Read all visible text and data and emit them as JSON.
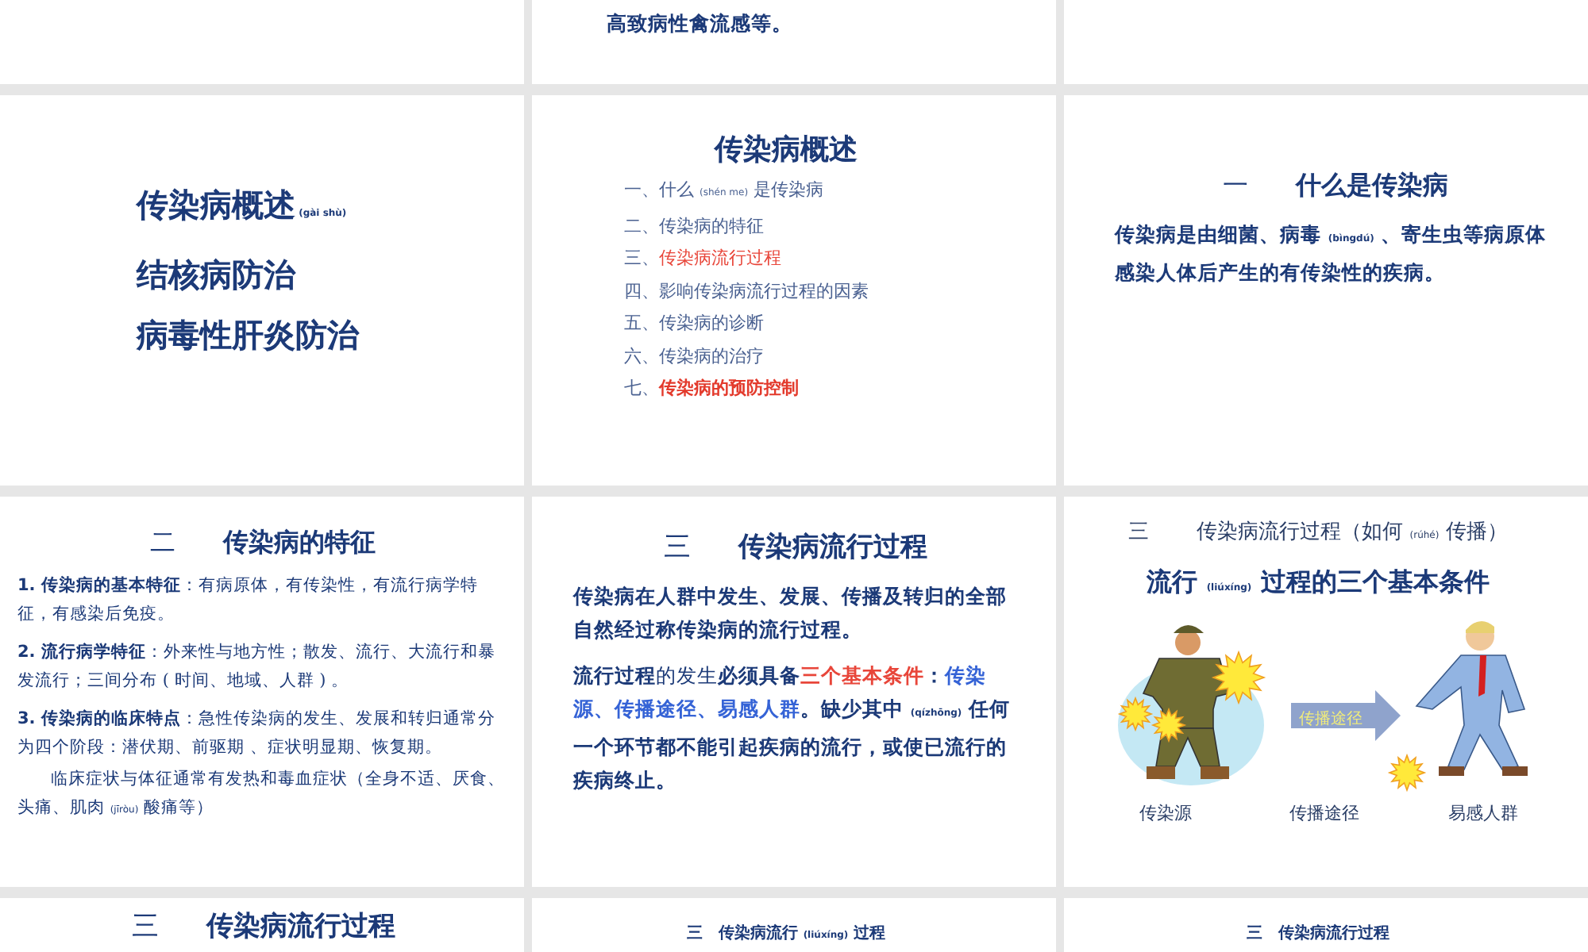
{
  "slides": [
    {
      "kind": "blank"
    },
    {
      "kind": "tail",
      "blocks": [
        {
          "kind": "para",
          "runs": [
            {
              "text": "高致病性禽流感等。",
              "kind": "bold"
            }
          ]
        }
      ]
    },
    {
      "kind": "blank"
    },
    {
      "kind": "menu",
      "blocks": [
        {
          "kind": "menu_line",
          "runs": [
            {
              "text": "传染病概述",
              "kind": "bold"
            },
            {
              "text": " (gài shù)",
              "kind": "pinyin"
            }
          ]
        },
        {
          "kind": "menu_line",
          "runs": [
            {
              "text": "结核病防治",
              "kind": "bold"
            }
          ]
        },
        {
          "kind": "menu_line",
          "runs": [
            {
              "text": "病毒性肝炎防治",
              "kind": "bold"
            }
          ]
        }
      ]
    },
    {
      "kind": "toc",
      "blocks": [
        {
          "kind": "toc_title",
          "runs": [
            {
              "text": "传染病概述",
              "kind": "bold"
            }
          ]
        },
        {
          "kind": "toc_item",
          "runs": [
            {
              "text": "一、什么 ",
              "kind": "plain"
            },
            {
              "text": "(shén me)",
              "kind": "pinyin"
            },
            {
              "text": " 是传染病",
              "kind": "plain"
            }
          ]
        },
        {
          "kind": "toc_item",
          "runs": [
            {
              "text": "二、传染病的特征",
              "kind": "plain"
            }
          ]
        },
        {
          "kind": "toc_item",
          "runs": [
            {
              "text": "三、",
              "kind": "plain"
            },
            {
              "text": "传染病流行过程",
              "kind": "red"
            }
          ]
        },
        {
          "kind": "toc_item",
          "runs": [
            {
              "text": "四、影响传染病流行过程的因素",
              "kind": "plain"
            }
          ]
        },
        {
          "kind": "toc_item",
          "runs": [
            {
              "text": "五、传染病的诊断",
              "kind": "plain"
            }
          ]
        },
        {
          "kind": "toc_item",
          "runs": [
            {
              "text": "六、传染病的治疗",
              "kind": "plain"
            }
          ]
        },
        {
          "kind": "toc_item",
          "runs": [
            {
              "text": "七、",
              "kind": "plain"
            },
            {
              "text": "传染病的预防控制",
              "kind": "red-bold"
            }
          ]
        }
      ]
    },
    {
      "kind": "section",
      "blocks": [
        {
          "kind": "heading",
          "number": "一",
          "title": "什么是传染病"
        },
        {
          "kind": "para",
          "runs": [
            {
              "text": "传染病是由细菌、病毒 ",
              "kind": "bold"
            },
            {
              "text": "(bìngdú)",
              "kind": "pinyin"
            },
            {
              "text": " 、寄生虫等病原体感染人体后产生的有传染性的疾病。",
              "kind": "bold"
            }
          ]
        }
      ]
    },
    {
      "kind": "list",
      "blocks": [
        {
          "kind": "heading",
          "number": "二",
          "title": "传染病的特征"
        },
        {
          "kind": "point",
          "number": "1.",
          "runs": [
            {
              "text": "传染病的基本特征",
              "kind": "bold"
            },
            {
              "text": "：有病原体，有传染性，有流行病学特征，有感染后免疫。",
              "kind": "plain"
            }
          ]
        },
        {
          "kind": "point",
          "number": "2.",
          "runs": [
            {
              "text": "流行病学特征",
              "kind": "bold"
            },
            {
              "text": "：外来性与地方性；散发、流行、大流行和暴发流行；三间分布 ( 时间、地域、人群 ) 。",
              "kind": "plain"
            }
          ]
        },
        {
          "kind": "point",
          "number": "3.",
          "runs": [
            {
              "text": "传染病的临床特点",
              "kind": "bold"
            },
            {
              "text": "：急性传染病的发生、发展和转归通常分为四个阶段：潜伏期、前驱期 、症状明显期、恢复期。",
              "kind": "plain"
            }
          ]
        },
        {
          "kind": "note",
          "runs": [
            {
              "text": "临床症状与体征通常有发热和毒血症状（全身不适、厌食、头痛、肌肉 ",
              "kind": "plain"
            },
            {
              "text": "(jīròu)",
              "kind": "pinyin"
            },
            {
              "text": " 酸痛等）",
              "kind": "plain"
            }
          ]
        }
      ]
    },
    {
      "kind": "content",
      "blocks": [
        {
          "kind": "heading",
          "number": "三",
          "title": "传染病流行过程"
        },
        {
          "kind": "para",
          "runs": [
            {
              "text": "传染病在人群中发生、发展、传播及转归的全部自然经过称传染病的流行过程。",
              "kind": "bold"
            }
          ]
        },
        {
          "kind": "para",
          "runs": [
            {
              "text": "流行过程",
              "kind": "bold"
            },
            {
              "text": "的发生",
              "kind": "plain"
            },
            {
              "text": "必须具备",
              "kind": "bold"
            },
            {
              "text": "三个基本条件",
              "kind": "red"
            },
            {
              "text": "：",
              "kind": "bold"
            },
            {
              "text": "传染源、传播途径、易感人群",
              "kind": "blue"
            },
            {
              "text": "。缺少其中 ",
              "kind": "bold"
            },
            {
              "text": "(qízhōng)",
              "kind": "pinyin"
            },
            {
              "text": " 任何一个环节都不能引起疾病的流行，或使已流行的疾病终止。",
              "kind": "bold"
            }
          ]
        }
      ]
    },
    {
      "kind": "figure",
      "blocks": [
        {
          "kind": "plain_title",
          "number": "三",
          "runs": [
            {
              "text": "传染病流行过程（如何 ",
              "kind": "plain"
            },
            {
              "text": "(rúhé)",
              "kind": "pinyin"
            },
            {
              "text": " 传播）",
              "kind": "plain"
            }
          ]
        },
        {
          "kind": "subtitle",
          "runs": [
            {
              "text": "流行 ",
              "kind": "bold"
            },
            {
              "text": "(liúxíng)",
              "kind": "pinyin"
            },
            {
              "text": " 过程的三个基本条件",
              "kind": "bold"
            }
          ]
        },
        {
          "kind": "figure",
          "arrow_label": "传播途径",
          "captions": [
            "传染源",
            "传播途径",
            "易感人群"
          ]
        }
      ]
    },
    {
      "kind": "peek",
      "blocks": [
        {
          "kind": "heading",
          "number": "三",
          "title": "传染病流行过程"
        }
      ]
    },
    {
      "kind": "small",
      "blocks": [
        {
          "kind": "small_heading",
          "runs": [
            {
              "text": "三　传染病流行 ",
              "kind": "bold"
            },
            {
              "text": "(liúxíng)",
              "kind": "pinyin"
            },
            {
              "text": " 过程",
              "kind": "bold"
            }
          ]
        }
      ]
    },
    {
      "kind": "small",
      "blocks": [
        {
          "kind": "small_heading",
          "runs": [
            {
              "text": "三　传染病流行过程",
              "kind": "bold"
            }
          ]
        }
      ]
    }
  ]
}
